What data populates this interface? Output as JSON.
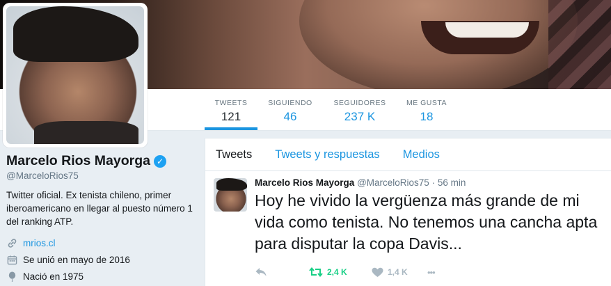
{
  "profile": {
    "name": "Marcelo Rios Mayorga",
    "handle": "@MarceloRios75",
    "bio": "Twitter oficial. Ex tenista chileno, primer iberoamericano en llegar al puesto número 1 del ranking ATP.",
    "website": "mrios.cl",
    "joined": "Se unió en mayo de 2016",
    "born": "Nació en 1975"
  },
  "stats": [
    {
      "label": "TWEETS",
      "value": "121"
    },
    {
      "label": "SIGUIENDO",
      "value": "46"
    },
    {
      "label": "SEGUIDORES",
      "value": "237 K"
    },
    {
      "label": "ME GUSTA",
      "value": "18"
    }
  ],
  "timeline_tabs": [
    "Tweets",
    "Tweets y respuestas",
    "Medios"
  ],
  "tweet": {
    "name": "Marcelo Rios Mayorga",
    "handle": "@MarceloRios75",
    "separator": "·",
    "time": "56 min",
    "text": "Hoy he vivido la vergüenza más grande de mi vida como tenista. No tenemos una cancha apta para disputar la copa Davis...",
    "retweets": "2,4 K",
    "likes": "1,4 K",
    "more": "•••"
  },
  "colors": {
    "accent": "#1b95e0",
    "verified": "#1da1f2",
    "retweet_green": "#19cf86",
    "muted": "#aab8c2",
    "page_bg": "#e8eef3"
  },
  "icons": [
    "verified-badge-icon",
    "link-icon",
    "calendar-icon",
    "balloon-icon",
    "reply-icon",
    "retweet-icon",
    "heart-icon",
    "more-icon"
  ]
}
